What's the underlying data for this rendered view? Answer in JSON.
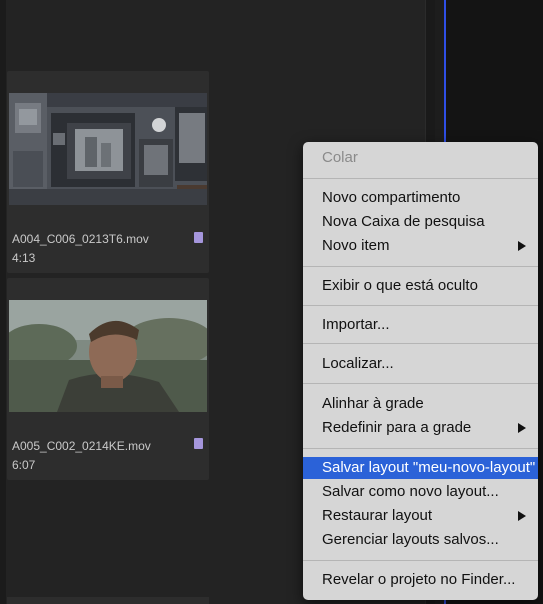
{
  "clips": [
    {
      "name": "A004_C006_0213T6.mov",
      "duration": "4:13",
      "label_color": "#a596dc"
    },
    {
      "name": "A005_C002_0214KE.mov",
      "duration": "6:07",
      "label_color": "#a596dc"
    }
  ],
  "context_menu": {
    "items": [
      {
        "label": "Colar",
        "disabled": true
      },
      {
        "label": "Novo compartimento"
      },
      {
        "label": "Nova Caixa de pesquisa"
      },
      {
        "label": "Novo item",
        "submenu": true
      },
      {
        "label": "Exibir o que está oculto"
      },
      {
        "label": "Importar..."
      },
      {
        "label": "Localizar..."
      },
      {
        "label": "Alinhar à grade"
      },
      {
        "label": "Redefinir para a grade",
        "submenu": true
      },
      {
        "label": "Salvar layout \"meu-novo-layout\"",
        "highlighted": true
      },
      {
        "label": "Salvar como novo layout..."
      },
      {
        "label": "Restaurar layout",
        "submenu": true
      },
      {
        "label": "Gerenciar layouts salvos..."
      },
      {
        "label": "Revelar o projeto no Finder..."
      }
    ]
  },
  "colors": {
    "menu_highlight": "#2b62d8",
    "panel_background": "#232323",
    "timeline_marker": "#2f4fe6"
  }
}
